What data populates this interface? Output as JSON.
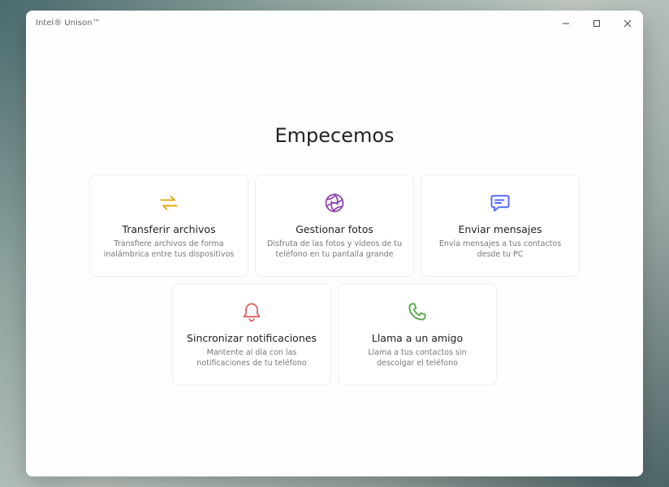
{
  "window": {
    "title": "Intel® Unison™"
  },
  "heading": "Empecemos",
  "cards": [
    {
      "title": "Transferir archivos",
      "desc": "Transfiere archivos de forma inalámbrica entre tus dispositivos"
    },
    {
      "title": "Gestionar fotos",
      "desc": "Disfruta de las fotos y vídeos de tu teléfono en tu pantalla grande"
    },
    {
      "title": "Enviar mensajes",
      "desc": "Envía mensajes a tus contactos desde tu PC"
    },
    {
      "title": "Sincronizar notificaciones",
      "desc": "Mantente al día con las notificaciones de tu teléfono"
    },
    {
      "title": "Llama a un amigo",
      "desc": "Llama a tus contactos sin descolgar el teléfono"
    }
  ],
  "colors": {
    "transfer": "#e6a817",
    "photos": "#8e44ad",
    "messages": "#5468ff",
    "notifications": "#e05a5a",
    "calls": "#5aa84f"
  }
}
